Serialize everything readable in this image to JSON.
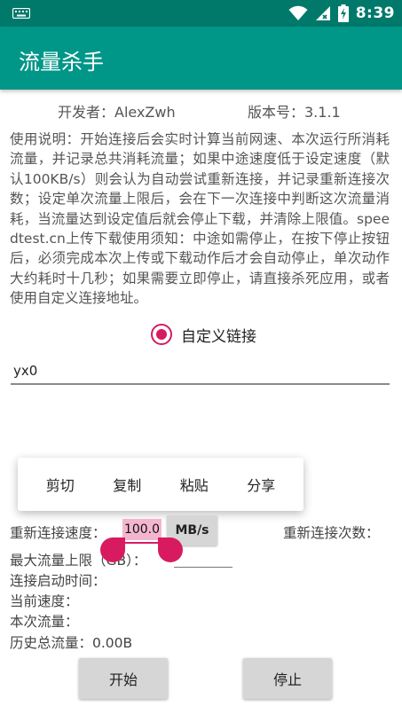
{
  "status_bar": {
    "time": "8:39"
  },
  "app_bar": {
    "title": "流量杀手"
  },
  "info": {
    "developer": "开发者：AlexZwh",
    "version": "版本号：3.1.1"
  },
  "description": "使用说明：开始连接后会实时计算当前网速、本次运行所消耗流量，并记录总共消耗流量；如果中途速度低于设定速度（默认100KB/s）则会认为自动尝试重新连接，并记录重新连接次数；设定单次流量上限后，会在下一次连接中判断这次流量消耗，当流量达到设定值后就会停止下载，并清除上限值。speedtest.cn上传下载使用须知：中途如需停止，在按下停止按钮后，必须完成本次上传或下载动作后才会自动停止，单次动作大约耗时十几秒；如果需要立即停止，请直接杀死应用，或者使用自定义连接地址。",
  "custom_link": {
    "label": "自定义链接",
    "checked": true,
    "url_value": "yx0"
  },
  "context_menu": {
    "items": [
      "剪切",
      "复制",
      "粘贴",
      "分享"
    ]
  },
  "reconnect": {
    "speed_label": "重新连接速度：",
    "speed_value": "100.0",
    "unit_label": "MB/s",
    "count_label": "重新连接次数："
  },
  "max_flow": {
    "label": "最大流量上限（GB）："
  },
  "stats": {
    "start_time": "连接启动时间：",
    "current_speed": "当前速度：",
    "session_flow": "本次流量：",
    "history_total": "历史总流量：0.00B"
  },
  "buttons": {
    "start": "开始",
    "stop": "停止"
  },
  "colors": {
    "primary_dark": "#00796b",
    "primary": "#009688",
    "accent": "#d81b60",
    "selection": "#f4b6cf"
  }
}
